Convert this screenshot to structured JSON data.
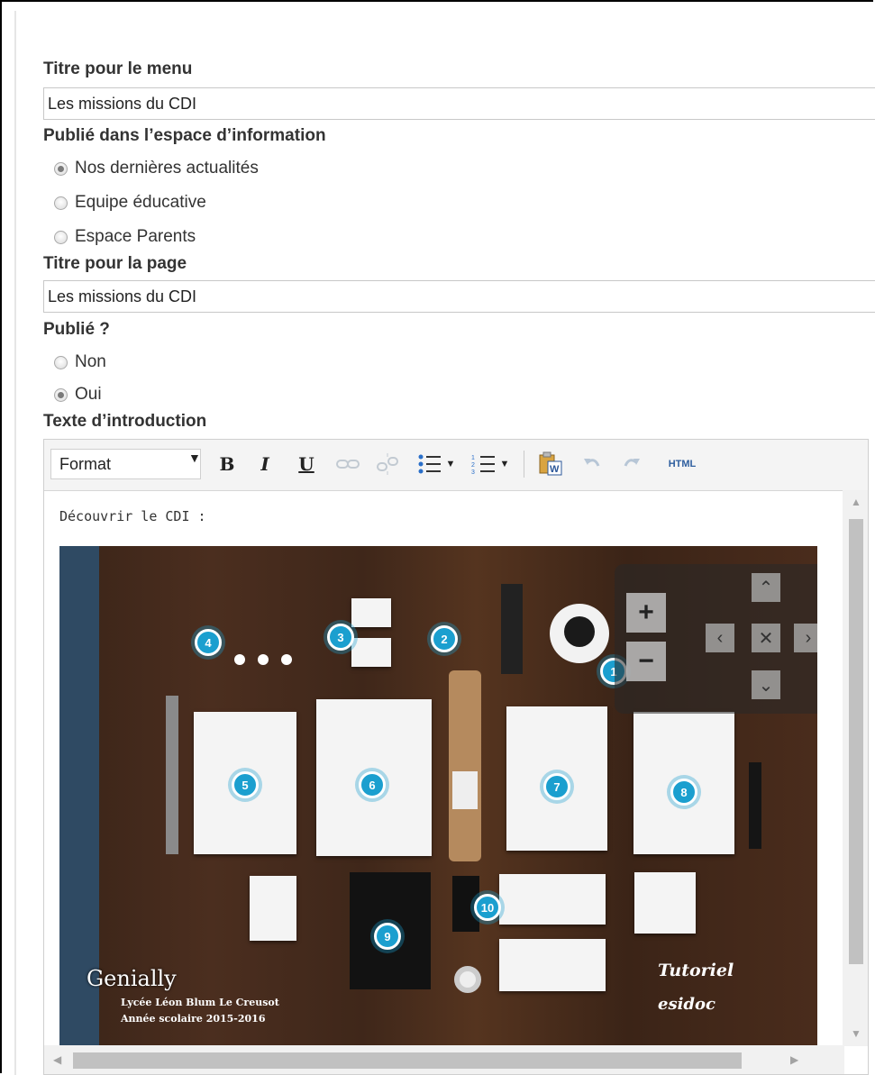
{
  "form": {
    "menu_title_label": "Titre pour le menu",
    "menu_title_value": "Les missions du CDI",
    "space_label": "Publié dans l’espace d’information",
    "space_options": [
      "Nos dernières actualités",
      "Equipe éducative",
      "Espace Parents"
    ],
    "space_selected": "Nos dernières actualités",
    "page_title_label": "Titre pour la page",
    "page_title_value": "Les missions du CDI",
    "published_label": "Publié ?",
    "published_options": [
      "Non",
      "Oui"
    ],
    "published_selected": "Oui",
    "intro_label": "Texte d’introduction"
  },
  "editor": {
    "format_label": "Format",
    "toolbar_icons": [
      "bold-icon",
      "italic-icon",
      "underline-icon",
      "link-icon",
      "unlink-icon",
      "bullet-list-icon",
      "numbered-list-icon",
      "paste-from-word-icon",
      "undo-icon",
      "redo-icon",
      "html-source-icon"
    ],
    "bold": "B",
    "italic": "I",
    "underline": "U",
    "html_label": "HTML",
    "content_text": "Découvrir le CDI :"
  },
  "image": {
    "markers": [
      "1",
      "2",
      "3",
      "4",
      "5",
      "6",
      "7",
      "8",
      "9",
      "10"
    ],
    "zoom_in": "+",
    "zoom_out": "−",
    "logo": "Genially",
    "credit_line1": "Lycée Léon Blum Le Creusot",
    "credit_line2": "Année scolaire 2015-2016",
    "tutorial_line1": "Tutoriel",
    "tutorial_line2": "esidoc"
  }
}
